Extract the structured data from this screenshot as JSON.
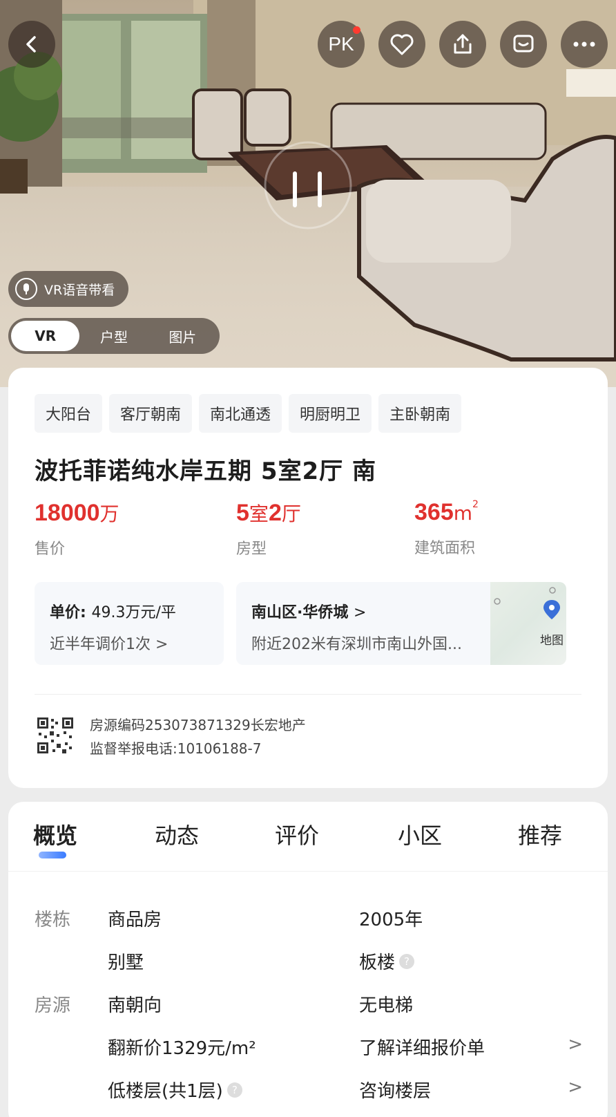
{
  "hero": {
    "vr_voice_label": "VR语音带看",
    "pk_label": "PK",
    "media_tabs": [
      "VR",
      "户型",
      "图片"
    ]
  },
  "tags": [
    "大阳台",
    "客厅朝南",
    "南北通透",
    "明厨明卫",
    "主卧朝南"
  ],
  "title": "波托菲诺纯水岸五期 5室2厅 南",
  "stats": {
    "price": {
      "value": "18000",
      "unit": "万",
      "label": "售价"
    },
    "layout": {
      "value1": "5",
      "unit1": "室",
      "value2": "2",
      "unit2": "厅",
      "label": "房型"
    },
    "area": {
      "value": "365",
      "unit": "m",
      "sup": "2",
      "label": "建筑面积"
    }
  },
  "unit_price": {
    "label": "单价:",
    "value": "49.3万元/平",
    "adjust": "近半年调价1次",
    "arrow": ">"
  },
  "location": {
    "district": "南山区·华侨城",
    "arrow": ">",
    "nearby": "附近202米有深圳市南山外国...",
    "map_label": "地图"
  },
  "registration": {
    "code_line": "房源编码253073871329长宏地产",
    "phone_line": "监督举报电话:10106188-7"
  },
  "detail_tabs": [
    "概览",
    "动态",
    "评价",
    "小区",
    "推荐"
  ],
  "details": {
    "building_label": "楼栋",
    "source_label": "房源",
    "property_type": "商品房",
    "year": "2005年",
    "category": "别墅",
    "building_type": "板楼",
    "orientation": "南朝向",
    "elevator": "无电梯",
    "renovation_price": "翻新价1329元/m²",
    "price_list_link": "了解详细报价单",
    "floor": "低楼层(共1层)",
    "floor_consult_link": "咨询楼层",
    "chevron": ">",
    "info_mark": "?"
  },
  "colors": {
    "accent_red": "#e0312e",
    "tab_blue": "#3a7bff"
  }
}
